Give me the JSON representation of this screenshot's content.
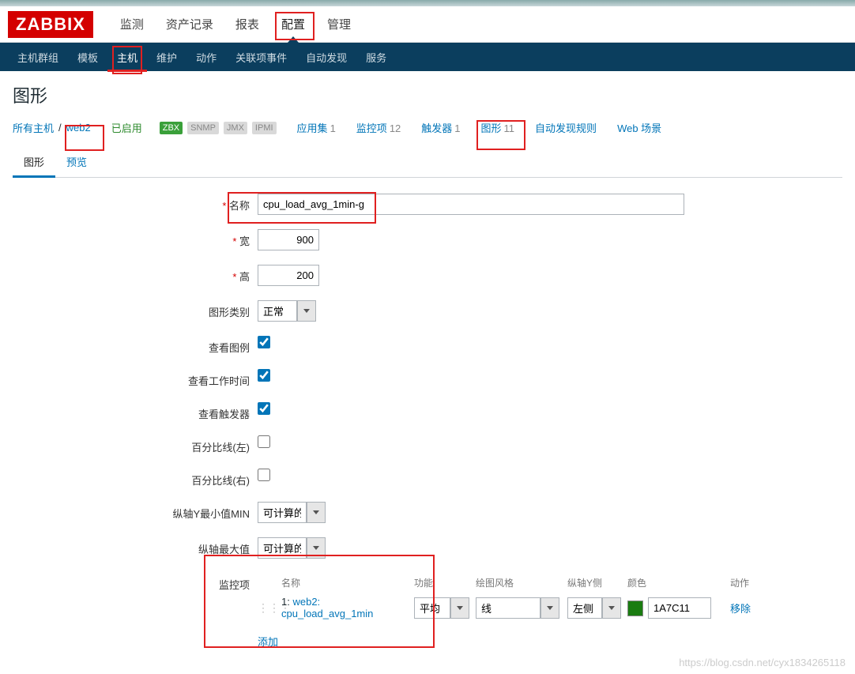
{
  "logo": "ZABBIX",
  "topnav": {
    "monitor": "监测",
    "inventory": "资产记录",
    "reports": "报表",
    "config": "配置",
    "admin": "管理"
  },
  "subnav": {
    "hostgroups": "主机群组",
    "templates": "模板",
    "hosts": "主机",
    "maintenance": "维护",
    "actions": "动作",
    "correlation": "关联项事件",
    "discovery": "自动发现",
    "services": "服务"
  },
  "page_title": "图形",
  "breadcrumb": {
    "all_hosts": "所有主机",
    "sep": "/",
    "host": "web2",
    "enabled": "已启用",
    "zbx": "ZBX",
    "snmp": "SNMP",
    "jmx": "JMX",
    "ipmi": "IPMI",
    "apps": {
      "label": "应用集",
      "count": "1"
    },
    "items": {
      "label": "监控项",
      "count": "12"
    },
    "triggers": {
      "label": "触发器",
      "count": "1"
    },
    "graphs": {
      "label": "图形",
      "count": "11"
    },
    "discovery_rules": "自动发现规则",
    "web": "Web 场景"
  },
  "tabs": {
    "graph": "图形",
    "preview": "预览"
  },
  "form": {
    "labels": {
      "name": "名称",
      "width": "宽",
      "height": "高",
      "type": "图形类别",
      "legend": "查看图例",
      "work": "查看工作时间",
      "triggers": "查看触发器",
      "pct_left": "百分比线(左)",
      "pct_right": "百分比线(右)",
      "ymin": "纵轴Y最小值MIN",
      "ymax": "纵轴最大值",
      "items": "监控项"
    },
    "values": {
      "name": "cpu_load_avg_1min-g",
      "width": "900",
      "height": "200",
      "type": "正常",
      "legend": true,
      "work": true,
      "triggers": true,
      "pct_left": false,
      "pct_right": false,
      "ymin": "可计算的",
      "ymax": "可计算的"
    },
    "item_headers": {
      "name": "名称",
      "func": "功能",
      "style": "绘图风格",
      "side": "纵轴Y侧",
      "color": "颜色",
      "action": "动作"
    },
    "items": [
      {
        "idx": "1:",
        "name": "web2: cpu_load_avg_1min",
        "func": "平均",
        "style": "线",
        "side": "左侧",
        "color": "1A7C11",
        "action": "移除"
      }
    ],
    "add": "添加"
  },
  "watermark": "https://blog.csdn.net/cyx1834265118"
}
